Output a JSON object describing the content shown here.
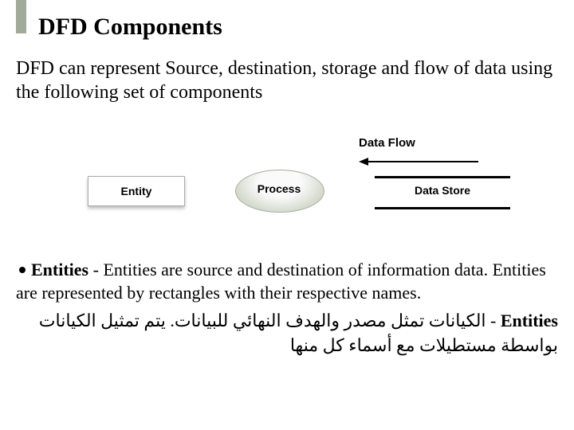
{
  "title": "DFD Components",
  "lead": "DFD can represent Source, destination, storage and flow of data using the following set of components",
  "diagram": {
    "data_flow": "Data Flow",
    "entity": "Entity",
    "process": "Process",
    "data_store": "Data Store"
  },
  "bullet": {
    "heading": "Entities",
    "text": " - Entities are source and destination of information data. Entities are represented by rectangles with their respective names."
  },
  "arabic": {
    "prefix": "Entities",
    "text": " - الكيانات تمثل مصدر والهدف النهائي للبيانات. يتم تمثيل الكيانات بواسطة مستطيلات مع أسماء كل منها"
  }
}
